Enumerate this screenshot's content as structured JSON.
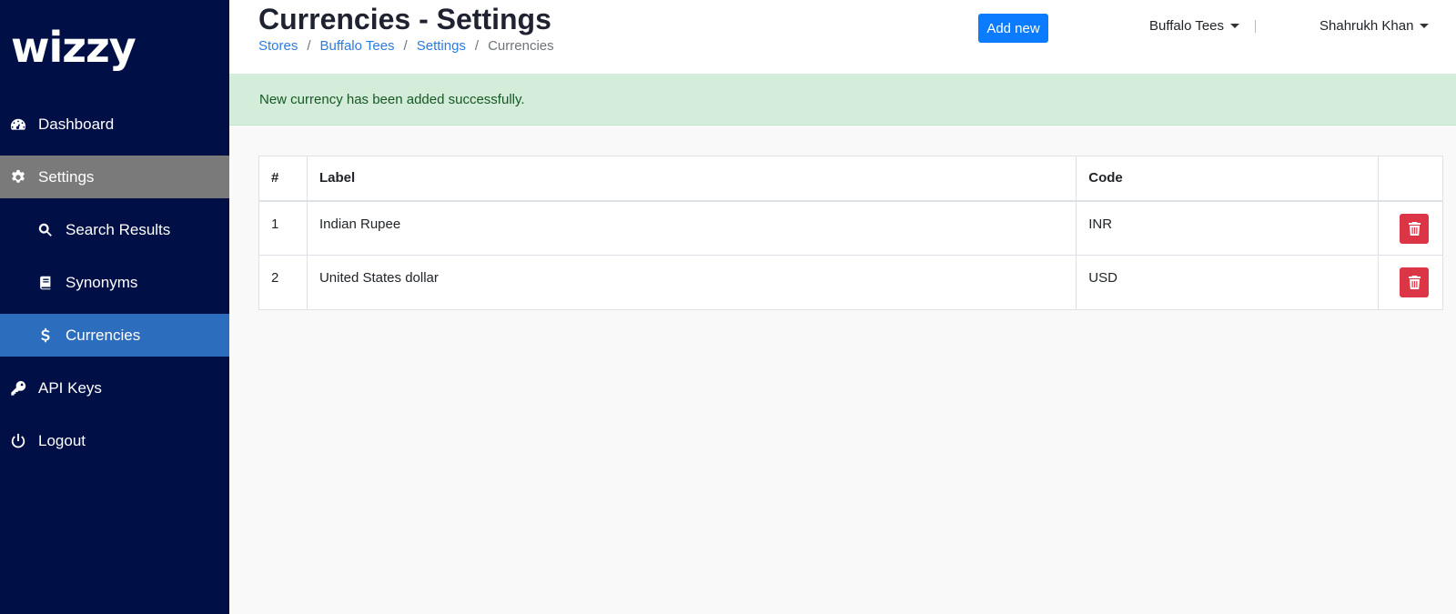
{
  "brand": {
    "logo_text": "wizzy"
  },
  "sidebar": {
    "items": [
      {
        "label": "Dashboard",
        "icon": "dashboard-icon"
      },
      {
        "label": "Settings",
        "icon": "gear-icon"
      },
      {
        "label": "Search Results",
        "icon": "search-icon"
      },
      {
        "label": "Synonyms",
        "icon": "book-icon"
      },
      {
        "label": "Currencies",
        "icon": "dollar-icon"
      },
      {
        "label": "API Keys",
        "icon": "key-icon"
      },
      {
        "label": "Logout",
        "icon": "power-icon"
      }
    ]
  },
  "header": {
    "title": "Currencies - Settings",
    "breadcrumb": [
      "Stores",
      "Buffalo Tees",
      "Settings",
      "Currencies"
    ],
    "breadcrumb_sep": "/",
    "add_button": "Add new",
    "store_dropdown": "Buffalo Tees",
    "user_dropdown": "Shahrukh Khan"
  },
  "alert": {
    "message": "New currency has been added successfully."
  },
  "table": {
    "headers": [
      "#",
      "Label",
      "Code",
      ""
    ],
    "rows": [
      {
        "num": "1",
        "label": "Indian Rupee",
        "code": "INR"
      },
      {
        "num": "2",
        "label": "United States dollar",
        "code": "USD"
      }
    ]
  },
  "colors": {
    "sidebar_bg": "#000f45",
    "active_item": "#2d6dbd",
    "active_parent": "#7a7a7a",
    "primary": "#0b7bff",
    "danger": "#dc3545",
    "success_bg": "#d4edda"
  }
}
